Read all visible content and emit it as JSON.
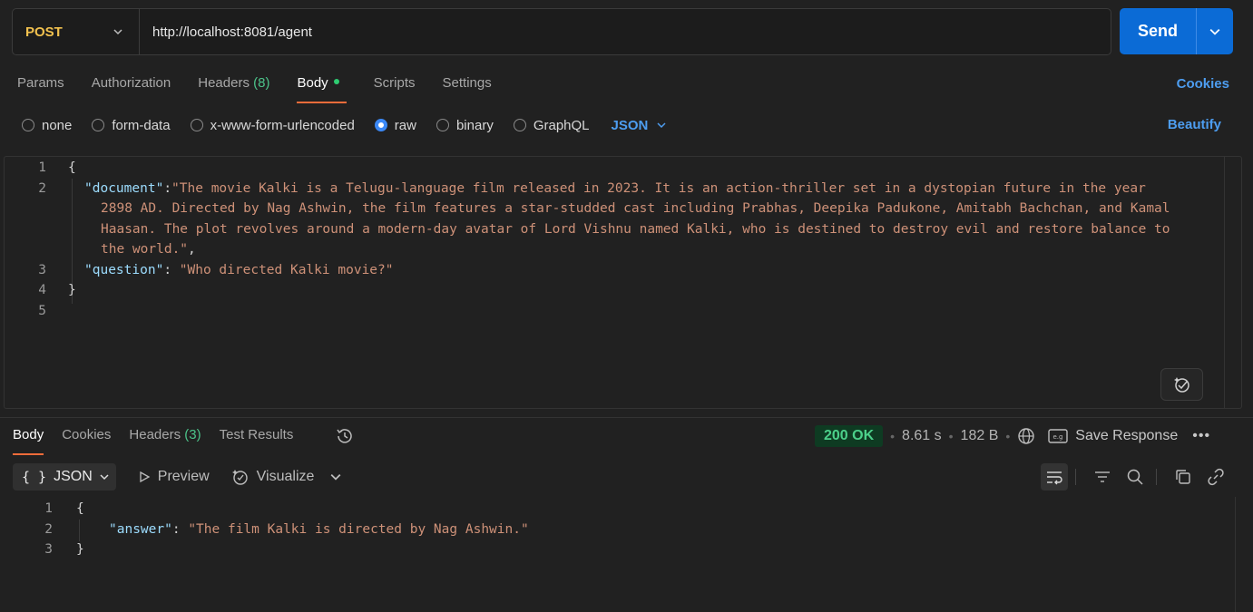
{
  "request": {
    "method": "POST",
    "url": "http://localhost:8081/agent",
    "send_label": "Send"
  },
  "request_tabs": [
    {
      "label": "Params"
    },
    {
      "label": "Authorization"
    },
    {
      "label": "Headers",
      "count": "(8)"
    },
    {
      "label": "Body"
    },
    {
      "label": "Scripts"
    },
    {
      "label": "Settings"
    }
  ],
  "cookies_label": "Cookies",
  "body_types": [
    "none",
    "form-data",
    "x-www-form-urlencoded",
    "raw",
    "binary",
    "GraphQL"
  ],
  "body_type_selected": "raw",
  "raw_format": "JSON",
  "beautify_label": "Beautify",
  "editor": {
    "line_numbers": [
      "1",
      "2",
      "3",
      "4",
      "5"
    ],
    "open_brace": "{",
    "close_brace": "}",
    "document_key": "\"document\"",
    "document_value_lines": [
      "\"The movie Kalki is a Telugu-language film released in 2023. It is an action-thriller set in a dystopian future in the year",
      "2898 AD. Directed by Nag Ashwin, the film features a star-studded cast including Prabhas, Deepika Padukone, Amitabh Bachchan, and Kamal",
      "Haasan. The plot revolves around a modern-day avatar of Lord Vishnu named Kalki, who is destined to destroy evil and restore balance to",
      "the world.\""
    ],
    "question_key": "\"question\"",
    "question_value": "\"Who directed Kalki movie?\""
  },
  "response_tabs": [
    {
      "label": "Body"
    },
    {
      "label": "Cookies"
    },
    {
      "label": "Headers",
      "count": "(3)"
    },
    {
      "label": "Test Results"
    }
  ],
  "response_meta": {
    "status": "200 OK",
    "time": "8.61 s",
    "size": "182 B",
    "save_label": "Save Response",
    "more": "•••"
  },
  "response_toolbar": {
    "format_braces": "{ }",
    "format_label": "JSON",
    "preview_label": "Preview",
    "visualize_label": "Visualize"
  },
  "response_body": {
    "line_numbers": [
      "1",
      "2",
      "3"
    ],
    "open_brace": "{",
    "close_brace": "}",
    "answer_key": "\"answer\"",
    "answer_value": "\"The film Kalki is directed by Nag Ashwin.\""
  },
  "colors": {
    "accent": "#0b6bd6",
    "method": "#f2c14e",
    "status_ok": "#4cd08a",
    "tab_underline": "#ef6c3a",
    "json_key": "#9cdcfe",
    "json_string": "#ce9178"
  }
}
